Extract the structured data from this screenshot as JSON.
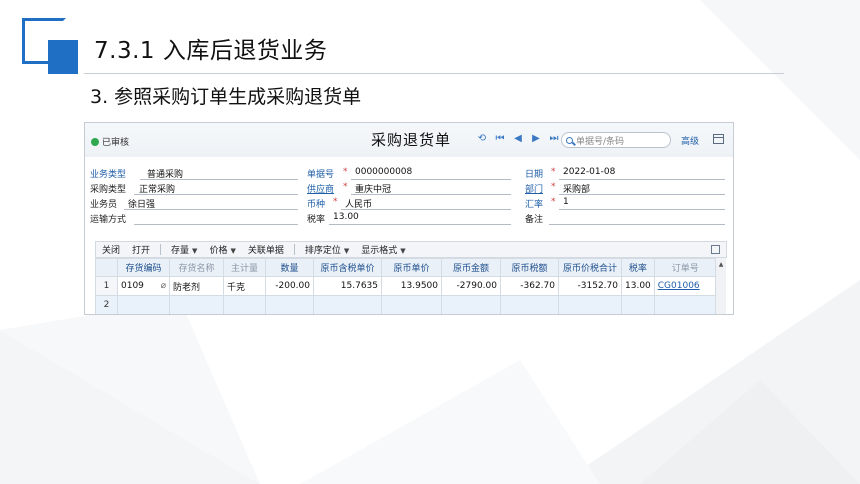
{
  "slide": {
    "title": "7.3.1  入库后退货业务",
    "subtitle": "3. 参照采购订单生成采购退货单"
  },
  "window": {
    "status": "已审核",
    "form_title": "采购退货单",
    "search_placeholder": "单据号/条码",
    "advanced": "高级"
  },
  "header_fields": {
    "biz_type": {
      "label": "业务类型",
      "value": "普通采购"
    },
    "bill_no": {
      "label": "单据号",
      "value": "0000000008"
    },
    "date": {
      "label": "日期",
      "value": "2022-01-08"
    },
    "purchase_type": {
      "label": "采购类型",
      "value": "正常采购"
    },
    "supplier": {
      "label": "供应商",
      "value": "重庆中冠"
    },
    "dept": {
      "label": "部门",
      "value": "采购部"
    },
    "clerk": {
      "label": "业务员",
      "value": "徐日强"
    },
    "currency": {
      "label": "币种",
      "value": "人民币"
    },
    "rate": {
      "label": "汇率",
      "value": "1"
    },
    "transport": {
      "label": "运输方式",
      "value": ""
    },
    "tax_rate": {
      "label": "税率",
      "value": "13.00"
    },
    "remark": {
      "label": "备注",
      "value": ""
    },
    "required_mark": "*"
  },
  "toolbar": {
    "close": "关闭",
    "open": "打开",
    "stock": "存量",
    "price": "价格",
    "link_doc": "关联单据",
    "sort": "排序定位",
    "display": "显示格式"
  },
  "grid": {
    "columns": [
      "存货编码",
      "存货名称",
      "主计量",
      "数量",
      "原币含税单价",
      "原币单价",
      "原币金额",
      "原币税额",
      "原币价税合计",
      "税率",
      "订单号"
    ],
    "rows": [
      {
        "no": "1",
        "code": "0109",
        "name": "防老剂",
        "unit": "千克",
        "qty": "-200.00",
        "tax_price": "15.7635",
        "price": "13.9500",
        "amount": "-2790.00",
        "tax": "-362.70",
        "total": "-3152.70",
        "rate": "13.00",
        "order": "CG01006"
      },
      {
        "no": "2"
      }
    ]
  }
}
